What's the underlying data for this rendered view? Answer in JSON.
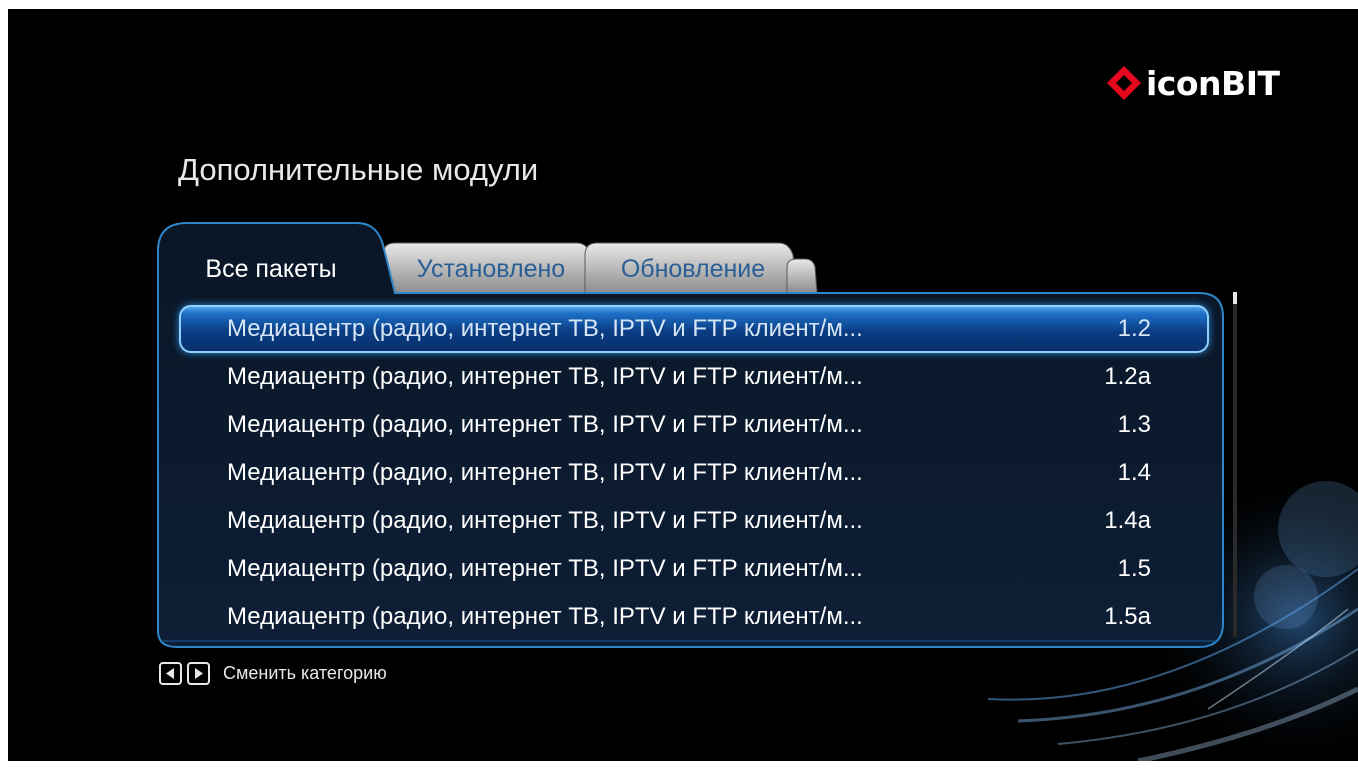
{
  "brand": {
    "logo_text": "iconBIT",
    "logo_color": "#e5081f"
  },
  "page": {
    "title": "Дополнительные модули"
  },
  "tabs": [
    {
      "label": "Все пакеты",
      "active": true
    },
    {
      "label": "Установлено",
      "active": false
    },
    {
      "label": "Обновление",
      "active": false
    }
  ],
  "packages": [
    {
      "name": "Медиацентр (радио, интернет ТВ, IPTV и FTP клиент/м...",
      "version": "1.2",
      "selected": true
    },
    {
      "name": "Медиацентр (радио, интернет ТВ, IPTV и FTP клиент/м...",
      "version": "1.2a",
      "selected": false
    },
    {
      "name": "Медиацентр (радио, интернет ТВ, IPTV и FTP клиент/м...",
      "version": "1.3",
      "selected": false
    },
    {
      "name": "Медиацентр (радио, интернет ТВ, IPTV и FTP клиент/м...",
      "version": "1.4",
      "selected": false
    },
    {
      "name": "Медиацентр (радио, интернет ТВ, IPTV и FTP клиент/м...",
      "version": "1.4a",
      "selected": false
    },
    {
      "name": "Медиацентр (радио, интернет ТВ, IPTV и FTP клиент/м...",
      "version": "1.5",
      "selected": false
    },
    {
      "name": "Медиацентр (радио, интернет ТВ, IPTV и FTP клиент/м...",
      "version": "1.5a",
      "selected": false
    }
  ],
  "footer": {
    "hint_keys": [
      "left-arrow-key-icon",
      "right-arrow-key-icon"
    ],
    "hint_text": "Сменить категорию"
  },
  "colors": {
    "background": "#000000",
    "accent_blue": "#1d6fc6",
    "panel_border": "#2e86c8",
    "inactive_tab_text": "#2a5f96"
  }
}
